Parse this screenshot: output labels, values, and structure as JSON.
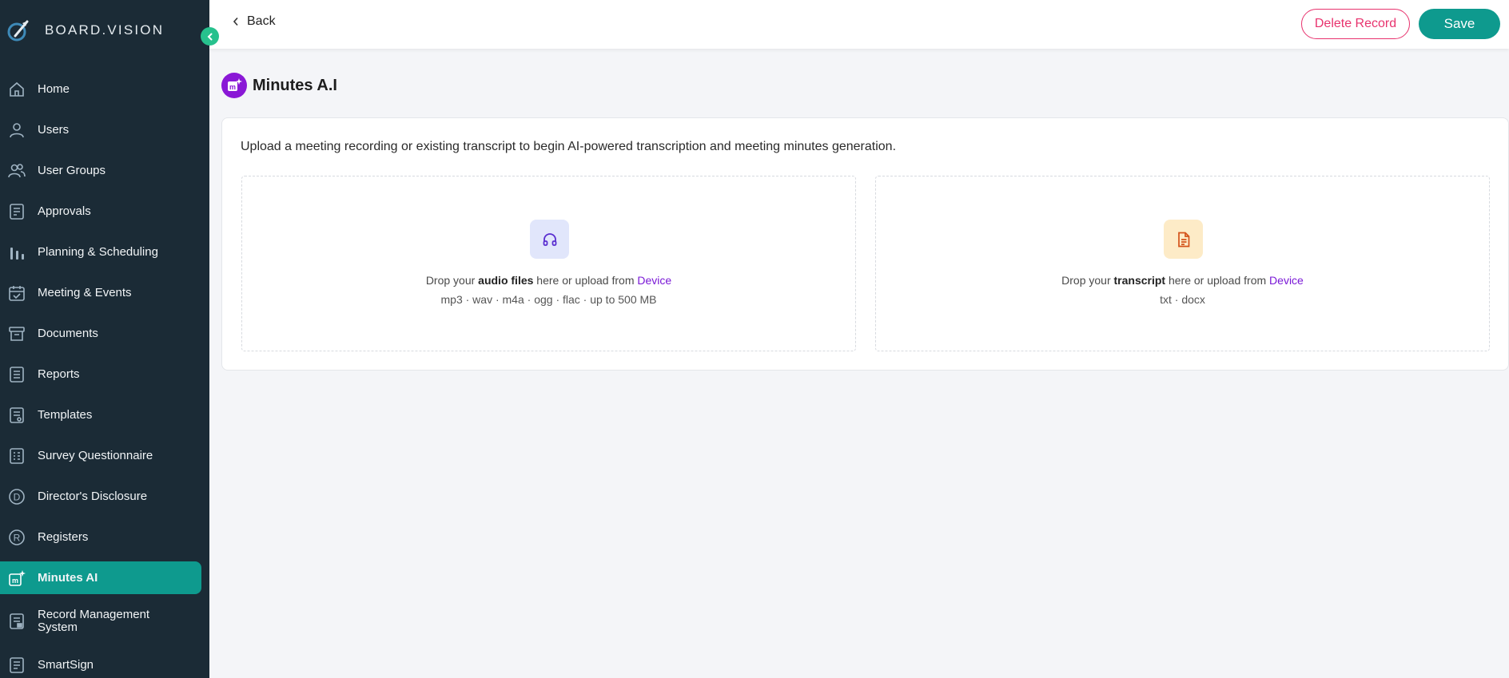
{
  "brand": {
    "name": "BOARD.VISION"
  },
  "sidebar": {
    "items": [
      {
        "label": "Home",
        "icon": "home-icon"
      },
      {
        "label": "Users",
        "icon": "user-icon"
      },
      {
        "label": "User Groups",
        "icon": "users-icon"
      },
      {
        "label": "Approvals",
        "icon": "approval-doc-icon"
      },
      {
        "label": "Planning & Scheduling",
        "icon": "bar-chart-icon"
      },
      {
        "label": "Meeting & Events",
        "icon": "calendar-check-icon"
      },
      {
        "label": "Documents",
        "icon": "archive-icon"
      },
      {
        "label": "Reports",
        "icon": "list-doc-icon"
      },
      {
        "label": "Templates",
        "icon": "template-icon"
      },
      {
        "label": "Survey Questionnaire",
        "icon": "survey-icon"
      },
      {
        "label": "Director's Disclosure",
        "icon": "circle-d-icon"
      },
      {
        "label": "Registers",
        "icon": "circle-r-icon"
      },
      {
        "label": "Minutes AI",
        "icon": "minutes-ai-icon",
        "active": true
      },
      {
        "label": "Record Management System",
        "icon": "record-icon"
      },
      {
        "label": "SmartSign",
        "icon": "smartsign-icon"
      }
    ]
  },
  "header": {
    "back_label": "Back",
    "delete_label": "Delete Record",
    "save_label": "Save"
  },
  "page": {
    "title": "Minutes A.I",
    "intro": "Upload a meeting recording or existing transcript to begin AI-powered transcription and meeting minutes generation."
  },
  "upload_audio": {
    "prefix": "Drop your ",
    "bold": "audio files",
    "middle": " here or upload from ",
    "link": "Device",
    "formats": "mp3 · wav · m4a · ogg · flac · up to 500 MB",
    "icon": "headphones-icon"
  },
  "upload_transcript": {
    "prefix": "Drop your ",
    "bold": "transcript",
    "middle": " here or upload from ",
    "link": "Device",
    "formats": "txt · docx",
    "icon": "document-icon"
  },
  "colors": {
    "sidebar_bg": "#1b2b36",
    "accent": "#0e9a8e",
    "danger": "#e8336e",
    "link": "#7a18d6",
    "collapse": "#27c18d"
  }
}
